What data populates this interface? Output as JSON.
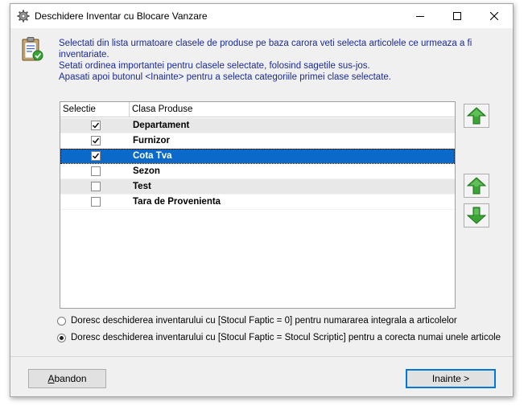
{
  "window": {
    "title": "Deschidere Inventar cu Blocare Vanzare",
    "icons": {
      "app": "gear-icon",
      "minimize": "minimize-icon",
      "maximize": "maximize-icon",
      "close": "close-icon"
    }
  },
  "instructions": {
    "line1": "Selectati din lista urmatoare clasele de produse pe baza carora veti selecta articolele ce urmeaza a fi inventariate.",
    "line2": "Setati ordinea importantei pentru clasele selectate, folosind sagetile sus-jos.",
    "line3": "Apasati apoi butonul <Inainte> pentru a selecta categoriile primei clase selectate."
  },
  "grid": {
    "headers": {
      "selection": "Selectie",
      "class": "Clasa Produse"
    },
    "rows": [
      {
        "label": "Departament",
        "checked": true
      },
      {
        "label": "Furnizor",
        "checked": true
      },
      {
        "label": "Cota Tva",
        "checked": true,
        "selected": true
      },
      {
        "label": "Sezon",
        "checked": false
      },
      {
        "label": "Test",
        "checked": false
      },
      {
        "label": "Tara de Provenienta",
        "checked": false
      }
    ]
  },
  "side_buttons": {
    "top": "arrow-up-icon",
    "up": "arrow-up-icon",
    "down": "arrow-down-icon",
    "color": "#3aa535"
  },
  "options": {
    "full_inventory": "Doresc deschiderea inventarului cu [Stocul Faptic = 0] pentru numararea integrala a articolelor",
    "partial_inventory": "Doresc deschiderea inventarului cu [Stocul Faptic = Stocul Scriptic] pentru a corecta numai unele articole",
    "selected": "partial_inventory"
  },
  "buttons": {
    "abandon_first": "A",
    "abandon_rest": "bandon",
    "next": "Inainte >"
  },
  "colors": {
    "instruction_text": "#1a2a96",
    "selection_highlight": "#0b6ac9",
    "arrow_green": "#3aa535"
  }
}
